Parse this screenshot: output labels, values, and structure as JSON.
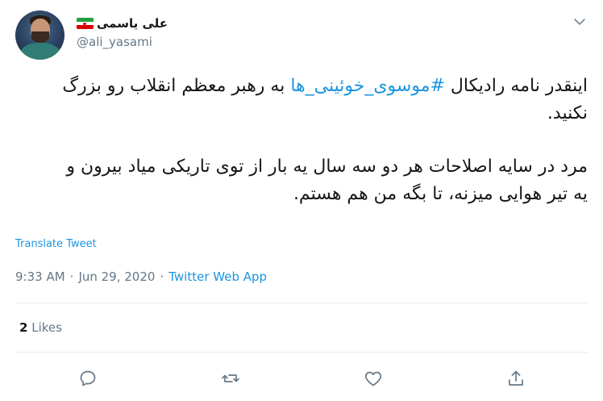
{
  "user": {
    "display_name": "علی یاسمی",
    "handle": "@ali_yasami"
  },
  "tweet": {
    "para1_before": "اینقدر نامه رادیکال ",
    "hashtag": "#موسوی_خوئینی_ها",
    "para1_after": " به رهبر معظم انقلاب رو بزرگ نکنید.",
    "para2": "مرد در سایه اصلاحات هر دو سه سال یه بار از توی تاریکی میاد بیرون و یه تیر هوایی میزنه، تا بگه من هم هستم."
  },
  "translate_label": "Translate Tweet",
  "meta": {
    "time": "9:33 AM",
    "separator": "·",
    "date": "Jun 29, 2020",
    "separator2": "·",
    "app": "Twitter Web App"
  },
  "stats": {
    "likes_count": "2",
    "likes_label": "Likes"
  },
  "icons": {
    "reply": "reply-icon",
    "retweet": "retweet-icon",
    "like": "heart-icon",
    "share": "share-icon",
    "more": "chevron-down-icon",
    "flag": "iran-flag-icon"
  },
  "colors": {
    "link": "#1b95e0",
    "muted": "#657786",
    "text": "#14171a",
    "icon": "#657786"
  }
}
